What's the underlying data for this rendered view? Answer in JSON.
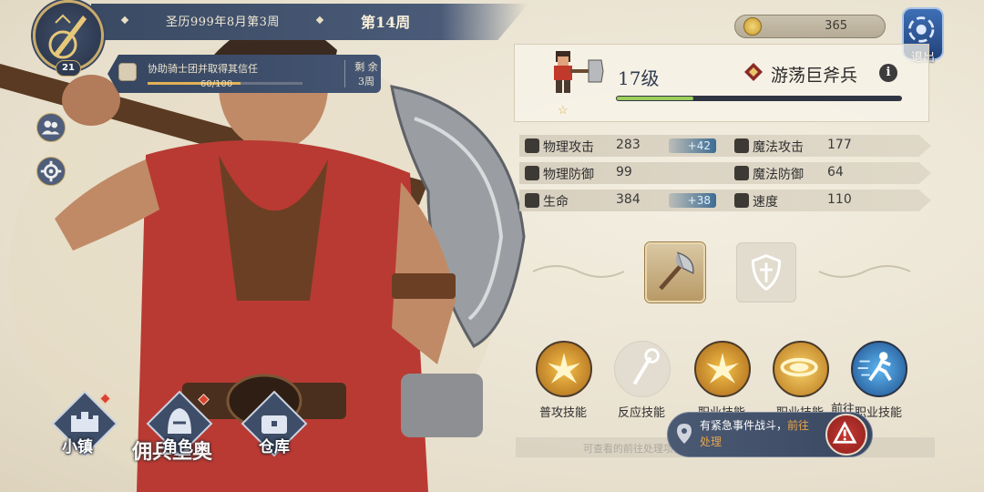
{
  "header": {
    "date": "圣历999年8月第3周",
    "week": "第14周",
    "player_level": "21"
  },
  "quest": {
    "title": "协助骑士团并取得其信任",
    "progress": "60/100",
    "progress_fraction": 0.6,
    "remaining": "剩 余",
    "remaining_value": "3周"
  },
  "currency": {
    "gold": "365"
  },
  "exit_label": "退出",
  "unit": {
    "level": "17级",
    "class_name": "游荡巨斧兵",
    "xp_fraction": 0.27
  },
  "stats": [
    {
      "label": "物理攻击",
      "value": "283",
      "bonus": "+42",
      "icon": "sword-icon"
    },
    {
      "label": "魔法攻击",
      "value": "177",
      "bonus": "",
      "icon": "wand-icon"
    },
    {
      "label": "物理防御",
      "value": "99",
      "bonus": "",
      "icon": "shield-icon"
    },
    {
      "label": "魔法防御",
      "value": "64",
      "bonus": "",
      "icon": "hat-icon"
    },
    {
      "label": "生命",
      "value": "384",
      "bonus": "+38",
      "icon": "heart-icon"
    },
    {
      "label": "速度",
      "value": "110",
      "bonus": "",
      "icon": "wing-icon"
    }
  ],
  "skills": [
    {
      "label": "普攻技能",
      "icon": "burst-icon"
    },
    {
      "label": "反应技能",
      "icon": "staff-icon"
    },
    {
      "label": "职业技能",
      "icon": "burst-icon"
    },
    {
      "label": "职业技能",
      "icon": "whirl-icon"
    },
    {
      "label": "职业技能",
      "icon": "runner-icon"
    }
  ],
  "overlay_text": "前往",
  "urgent": {
    "text": "有紧急事件战斗，",
    "link_part1": "前往",
    "link_part2": "处理"
  },
  "ghost_text": "佣兵里奥",
  "ghost_row_text": "可查看的前往处理项目",
  "nav": [
    {
      "label": "小镇",
      "icon": "castle-icon"
    },
    {
      "label": "角色",
      "icon": "helmet-icon"
    },
    {
      "label": "仓库",
      "icon": "chest-icon"
    }
  ],
  "colors": {
    "banner": "#3a4a63",
    "gold_trim": "#c9ab6a",
    "bonus_blue": "#3d6c92",
    "xp_green": "#9ccf5c",
    "urgent_red": "#c63a33"
  }
}
